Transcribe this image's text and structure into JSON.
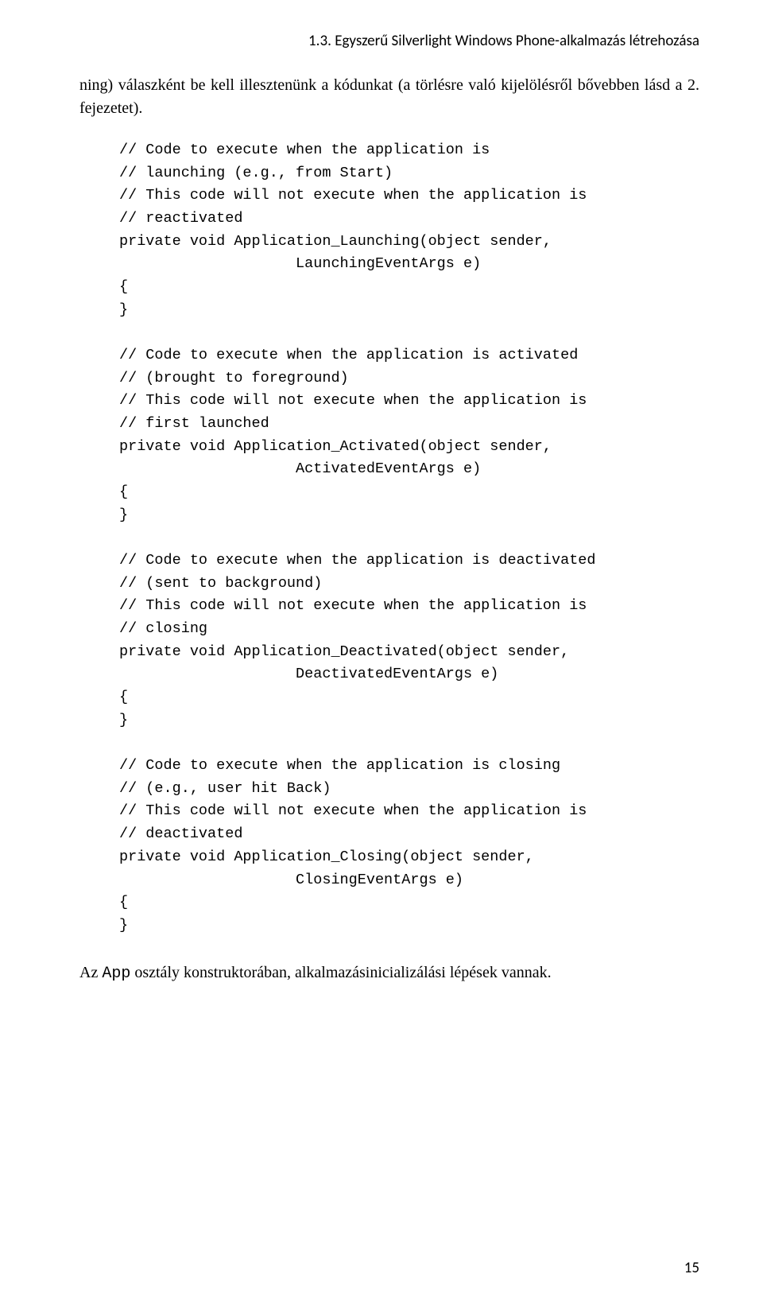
{
  "header": "1.3. Egyszerű Silverlight Windows Phone-alkalmazás létrehozása",
  "intro": "ning) válaszként be kell illesztenünk a kódunkat (a törlésre való kijelölésről bővebben lásd a 2. fejezetet).",
  "code": "// Code to execute when the application is\n// launching (e.g., from Start)\n// This code will not execute when the application is\n// reactivated\nprivate void Application_Launching(object sender,\n                    LaunchingEventArgs e)\n{\n}\n\n// Code to execute when the application is activated\n// (brought to foreground)\n// This code will not execute when the application is\n// first launched\nprivate void Application_Activated(object sender,\n                    ActivatedEventArgs e)\n{\n}\n\n// Code to execute when the application is deactivated\n// (sent to background)\n// This code will not execute when the application is\n// closing\nprivate void Application_Deactivated(object sender,\n                    DeactivatedEventArgs e)\n{\n}\n\n// Code to execute when the application is closing\n// (e.g., user hit Back)\n// This code will not execute when the application is\n// deactivated\nprivate void Application_Closing(object sender,\n                    ClosingEventArgs e)\n{\n}",
  "footer_prefix": "Az ",
  "footer_mono": "App",
  "footer_suffix": " osztály konstruktorában, alkalmazásinicializálási lépések vannak.",
  "page_number": "15"
}
